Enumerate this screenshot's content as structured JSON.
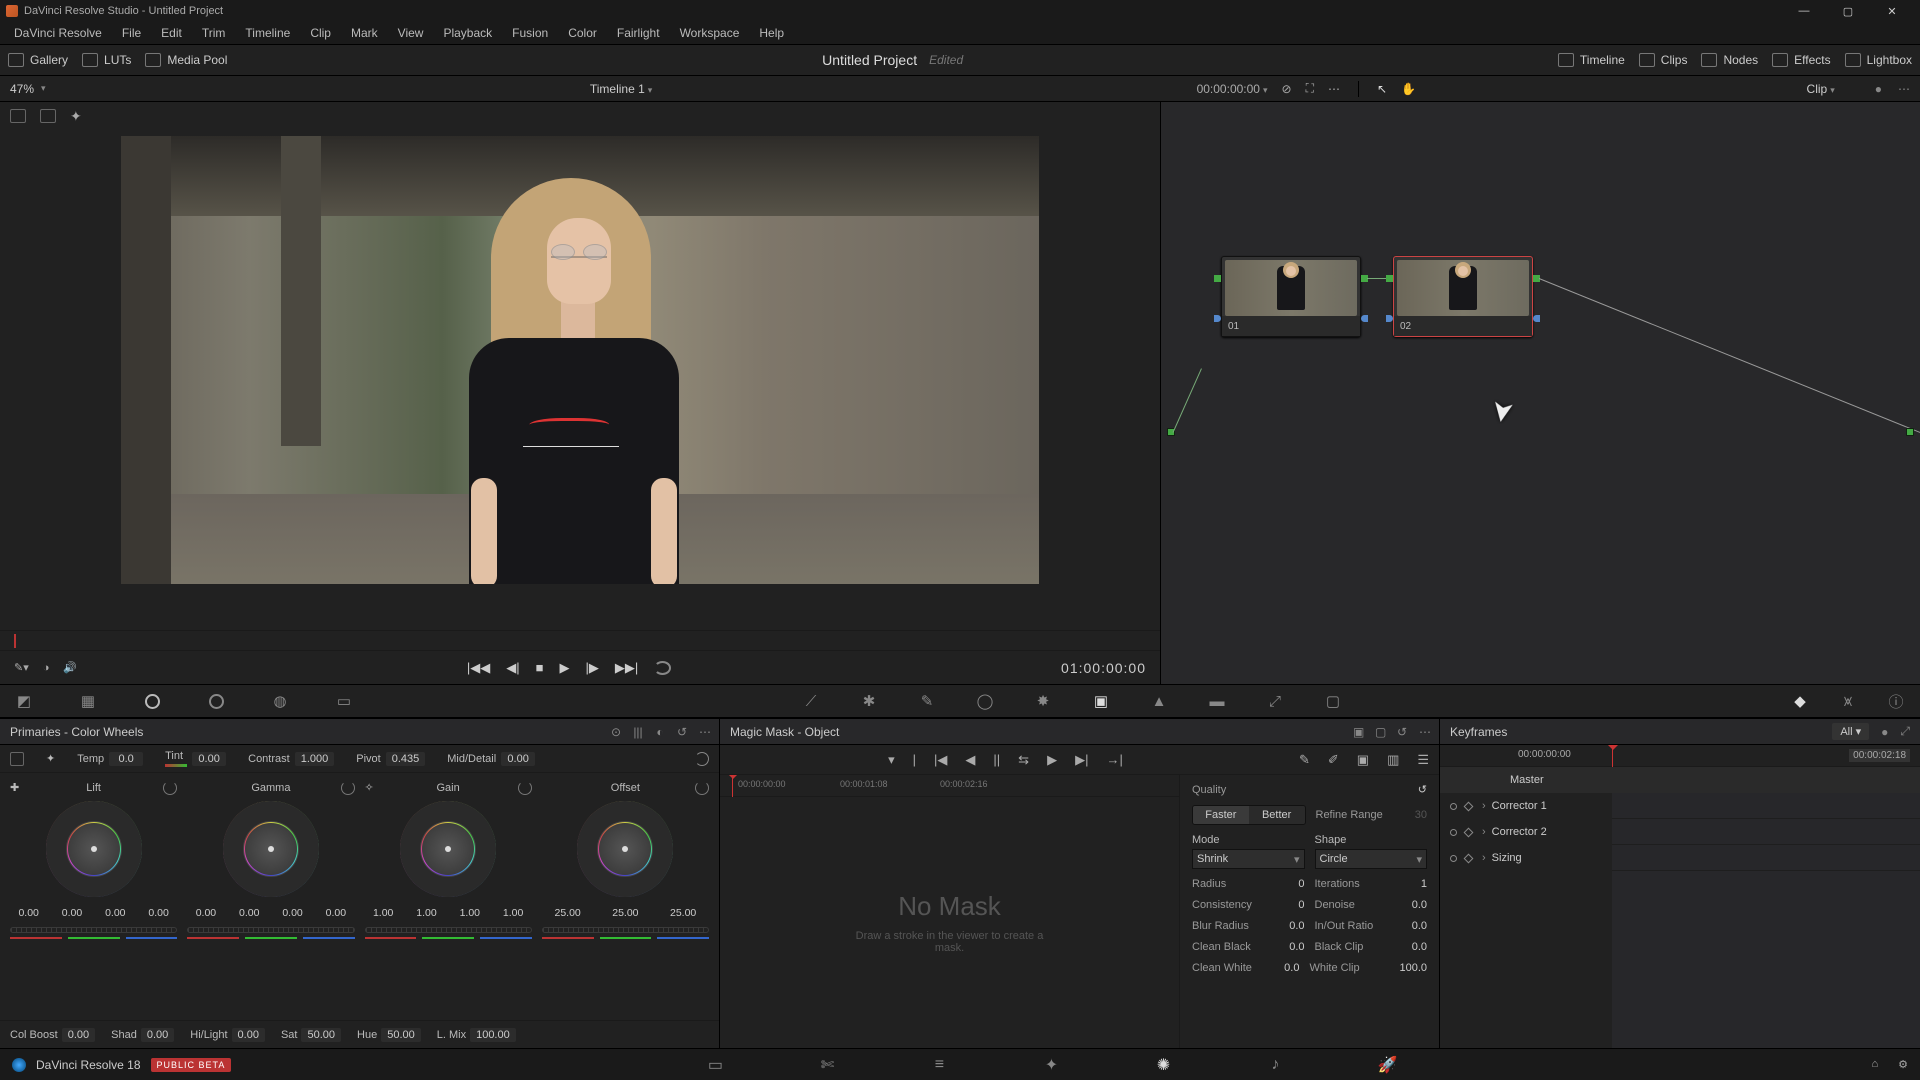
{
  "window_title": "DaVinci Resolve Studio - Untitled Project",
  "menu": [
    "DaVinci Resolve",
    "File",
    "Edit",
    "Trim",
    "Timeline",
    "Clip",
    "Mark",
    "View",
    "Playback",
    "Fusion",
    "Color",
    "Fairlight",
    "Workspace",
    "Help"
  ],
  "top_tools": {
    "gallery": "Gallery",
    "luts": "LUTs",
    "media_pool": "Media Pool",
    "project_title": "Untitled Project",
    "project_status": "Edited",
    "timeline": "Timeline",
    "clips": "Clips",
    "nodes": "Nodes",
    "effects": "Effects",
    "lightbox": "Lightbox"
  },
  "viewer": {
    "zoom": "47%",
    "timeline_name": "Timeline 1",
    "tc_header": "00:00:00:00",
    "tc_transport": "01:00:00:00"
  },
  "node_panel_mode": "Clip",
  "nodes": [
    {
      "label": "01",
      "selected": false
    },
    {
      "label": "02",
      "selected": true
    }
  ],
  "primaries": {
    "title": "Primaries - Color Wheels",
    "top": {
      "temp_label": "Temp",
      "temp": "0.0",
      "tint_label": "Tint",
      "tint": "0.00",
      "contrast_label": "Contrast",
      "contrast": "1.000",
      "pivot_label": "Pivot",
      "pivot": "0.435",
      "md_label": "Mid/Detail",
      "md": "0.00"
    },
    "wheels": [
      {
        "name": "Lift",
        "vals": [
          "0.00",
          "0.00",
          "0.00",
          "0.00"
        ]
      },
      {
        "name": "Gamma",
        "vals": [
          "0.00",
          "0.00",
          "0.00",
          "0.00"
        ]
      },
      {
        "name": "Gain",
        "vals": [
          "1.00",
          "1.00",
          "1.00",
          "1.00"
        ]
      },
      {
        "name": "Offset",
        "vals": [
          "25.00",
          "25.00",
          "25.00"
        ]
      }
    ],
    "bottom": {
      "col_boost_label": "Col Boost",
      "col_boost": "0.00",
      "shad_label": "Shad",
      "shad": "0.00",
      "hilight_label": "Hi/Light",
      "hilight": "0.00",
      "sat_label": "Sat",
      "sat": "50.00",
      "hue_label": "Hue",
      "hue": "50.00",
      "lmix_label": "L. Mix",
      "lmix": "100.00"
    }
  },
  "magic_mask": {
    "title": "Magic Mask - Object",
    "nomask_title": "No Mask",
    "nomask_sub": "Draw a stroke in the viewer to create a mask.",
    "timecodes": [
      "00:00:00:00",
      "00:00:01:08",
      "00:00:02:16"
    ],
    "quality_label": "Quality",
    "faster": "Faster",
    "better": "Better",
    "refine_label": "Refine Range",
    "refine_val": "30",
    "mode_label": "Mode",
    "mode_val": "Shrink",
    "shape_label": "Shape",
    "shape_val": "Circle",
    "radius_label": "Radius",
    "radius_val": "0",
    "iter_label": "Iterations",
    "iter_val": "1",
    "consist_label": "Consistency",
    "consist_val": "0",
    "denoise_label": "Denoise",
    "denoise_val": "0.0",
    "blur_label": "Blur Radius",
    "blur_val": "0.0",
    "io_label": "In/Out Ratio",
    "io_val": "0.0",
    "cblack_label": "Clean Black",
    "cblack_val": "0.0",
    "bclip_label": "Black Clip",
    "bclip_val": "0.0",
    "cwhite_label": "Clean White",
    "cwhite_val": "0.0",
    "wclip_label": "White Clip",
    "wclip_val": "100.0"
  },
  "keyframes": {
    "title": "Keyframes",
    "filter": "All",
    "tc_start": "00:00:00:00",
    "tc_end": "00:00:02:18",
    "master": "Master",
    "rows": [
      "Corrector 1",
      "Corrector 2",
      "Sizing"
    ]
  },
  "footer": {
    "version": "DaVinci Resolve 18",
    "beta": "PUBLIC BETA"
  }
}
